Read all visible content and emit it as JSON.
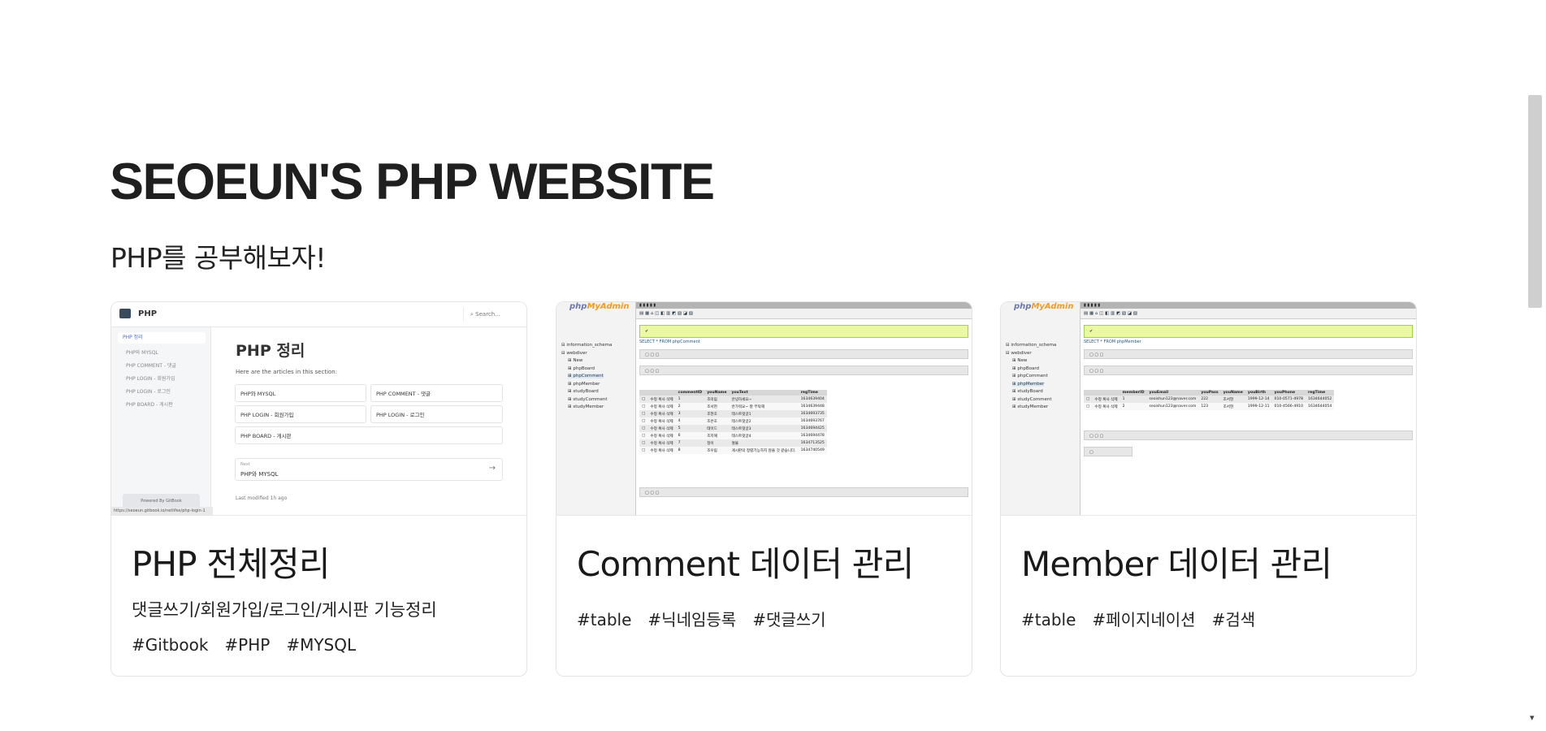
{
  "site": {
    "title": "SEOEUN'S PHP WEBSITE",
    "subtitle": "PHP를 공부해보자!"
  },
  "cards": [
    {
      "title": "PHP 전체정리",
      "description": "댓글쓰기/회원가입/로그인/게시판 기능정리",
      "tags": [
        "#Gitbook",
        "#PHP",
        "#MYSQL"
      ],
      "thumb": {
        "app_name": "PHP",
        "search_placeholder": "Search...",
        "sidebar_head": "PHP 정리",
        "sidebar_items": [
          "PHP와 MYSQL",
          "PHP COMMENT - 댓글",
          "PHP LOGIN - 회원가입",
          "PHP LOGIN - 로그인",
          "PHP BOARD - 게시판"
        ],
        "heading": "PHP 정리",
        "intro": "Here are the articles in this section:",
        "articles": [
          "PHP와 MYSQL",
          "PHP COMMENT - 댓글",
          "PHP LOGIN - 회원가입",
          "PHP LOGIN - 로그인",
          "PHP BOARD - 게시판"
        ],
        "next_label": "Next",
        "next_title": "PHP와 MYSQL",
        "powered": "Powered By GitBook",
        "modified": "Last modified 1h ago",
        "url": "https://seoeun.gitbook.io/netlifes/php-login-1"
      }
    },
    {
      "title": "Comment 데이터 관리",
      "tags": [
        "#table",
        "#닉네임등록",
        "#댓글쓰기"
      ],
      "thumb": {
        "crumb": "SELECT * FROM phpComment",
        "tree": [
          "information_schema",
          "webdiver",
          "New",
          "phpBoard",
          "phpComment",
          "phpMember",
          "studyBoard",
          "studyComment",
          "studyMember"
        ],
        "selected_index": 4,
        "columns": [
          "",
          "",
          "commentID",
          "youName",
          "youText",
          "regTime"
        ],
        "rows": [
          [
            "수정 복사 삭제",
            "1",
            "조미림",
            "안녕하세요~",
            "1634639404"
          ],
          [
            "수정 복사 삭제",
            "2",
            "조서현",
            "반가워요~ 잘 부탁해",
            "1634639448"
          ],
          [
            "수정 복사 삭제",
            "3",
            "조현호",
            "테스트댓글1",
            "1634693735"
          ],
          [
            "수정 복사 삭제",
            "4",
            "조은호",
            "테스트댓글2",
            "1634693767"
          ],
          [
            "수정 복사 삭제",
            "5",
            "테이드",
            "테스트댓글3",
            "1634694425"
          ],
          [
            "수정 복사 삭제",
            "6",
            "조지혜",
            "테스트댓글4",
            "1634694478"
          ],
          [
            "수정 복사 삭제",
            "7",
            "정이",
            "절불",
            "1634713525"
          ],
          [
            "수정 복사 삭제",
            "8",
            "조우림",
            "게시판의 정렬기능하지 않을 것 같습니다.",
            "1634740549"
          ]
        ]
      }
    },
    {
      "title": "Member 데이터 관리",
      "tags": [
        "#table",
        "#페이지네이션",
        "#검색"
      ],
      "thumb": {
        "crumb": "SELECT * FROM phpMember",
        "tree": [
          "information_schema",
          "webdiver",
          "New",
          "phpBoard",
          "phpComment",
          "phpMember",
          "studyBoard",
          "studyComment",
          "studyMember"
        ],
        "selected_index": 5,
        "columns": [
          "",
          "",
          "memberID",
          "youEmail",
          "youPass",
          "youName",
          "youBirth",
          "youPhone",
          "regTime"
        ],
        "rows": [
          [
            "수정 복사 삭제",
            "1",
            "seoishun123@naver.com",
            "222",
            "조서현",
            "1999-12-14",
            "010-0571-4978",
            "1634644052"
          ],
          [
            "수정 복사 삭제",
            "2",
            "seoishun123@naver.com",
            "123",
            "조서현",
            "1999-12-11",
            "010-4566-4910",
            "1634644054"
          ]
        ]
      }
    }
  ]
}
